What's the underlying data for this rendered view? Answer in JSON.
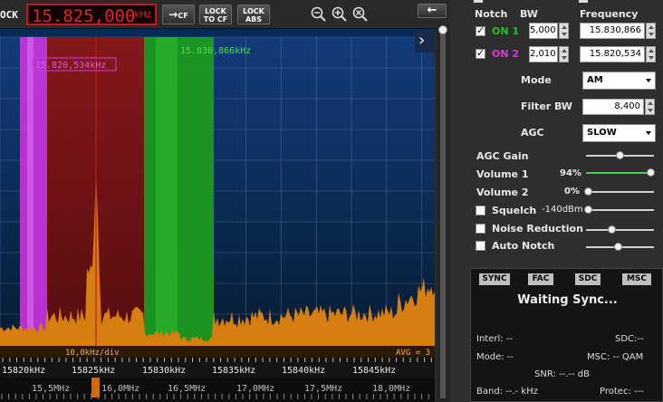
{
  "toolbar": {
    "lock_partial": "OCK",
    "frequency": "15.825,000",
    "freq_unit": "kHz",
    "cf_label": "CF",
    "lock_to_cf": [
      "LOCK",
      "TO CF"
    ],
    "lock_abs": [
      "LOCK",
      "ABS"
    ]
  },
  "spectrum": {
    "marker_green": "15.830,866kHz",
    "marker_magenta": "15.820,534kHz",
    "div_label": "10,0kHz/div",
    "avg_label": "AVG = 3",
    "colors": {
      "bg_top": "#0d2f6a",
      "bg_bottom": "#06223c",
      "magenta": "#d23be8",
      "green": "#1fa81f",
      "red": "#7a1010",
      "orange": "#e88a14"
    }
  },
  "scale": {
    "row1": [
      "15820kHz",
      "15825kHz",
      "15830kHz",
      "15835kHz",
      "15840kHz",
      "15845kHz"
    ],
    "row2": [
      "15,5MHz",
      "16,0MHz",
      "16,5MHz",
      "17,0MHz",
      "17,5MHz",
      "18,0MHz"
    ]
  },
  "notch": {
    "headers": {
      "notch": "Notch",
      "bw": "BW",
      "frequency": "Frequency"
    },
    "rows": [
      {
        "label": "ON 1",
        "bw": "5,000",
        "freq": "15.830,866",
        "color": "#22c322",
        "checked": true
      },
      {
        "label": "ON 2",
        "bw": "2,010",
        "freq": "15.820,534",
        "color": "#d63ad6",
        "checked": true
      }
    ]
  },
  "mode": {
    "label": "Mode",
    "value": "AM"
  },
  "filter": {
    "label": "Filter BW",
    "value": "8,400"
  },
  "agc": {
    "label": "AGC",
    "value": "SLOW"
  },
  "sliders": {
    "agc_gain": {
      "label": "AGC Gain",
      "value": ""
    },
    "volume1": {
      "label": "Volume 1",
      "value": "94%",
      "level": 0.94
    },
    "volume2": {
      "label": "Volume 2",
      "value": "0%",
      "level": 0.0
    },
    "squelch": {
      "label": "Squelch",
      "value": "-140dBm",
      "level": 0.0
    },
    "noise_reduction": {
      "label": "Noise Reduction",
      "level": 0.35
    },
    "auto_notch": {
      "label": "Auto Notch",
      "level": 0.45
    }
  },
  "drm": {
    "labels": [
      "SYNC",
      "FAC",
      "SDC",
      "MSC"
    ],
    "status": "Waiting Sync...",
    "interl": "Interl: --",
    "sdc": "SDC:--",
    "mode": "Mode: --",
    "msc": "MSC: -- QAM",
    "snr": "SNR: --.-- dB",
    "band": "Band: --.- kHz",
    "protec": "Protec: ---"
  }
}
